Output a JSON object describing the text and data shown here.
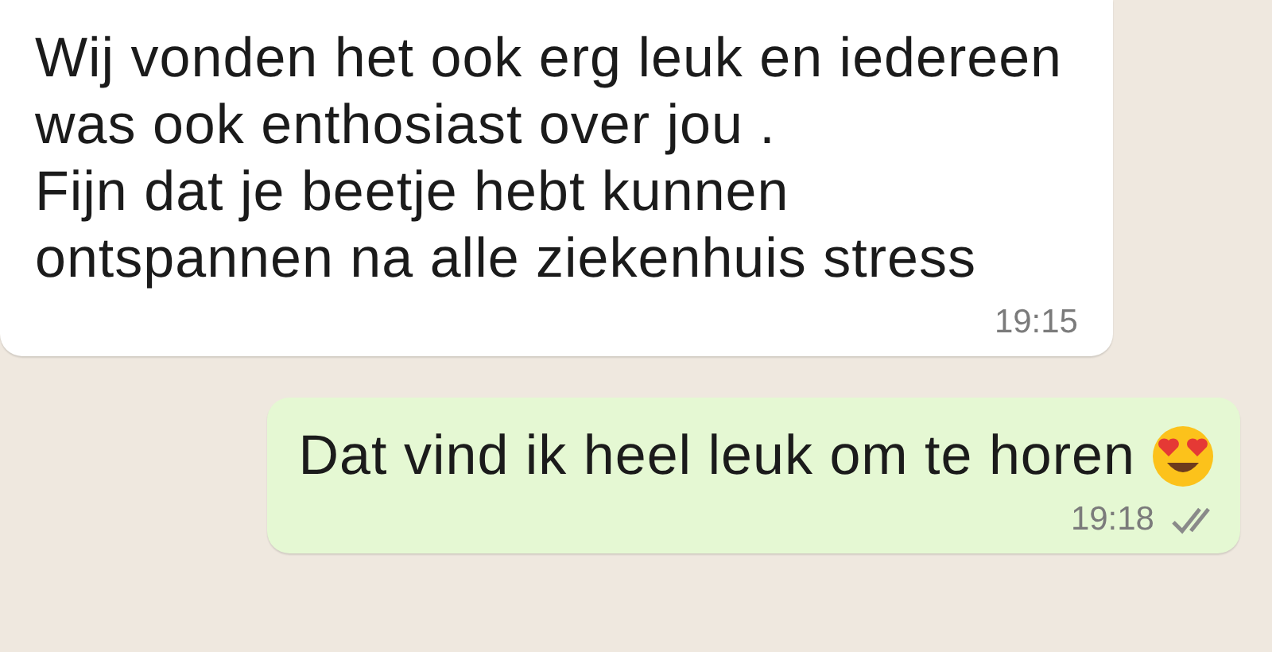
{
  "messages": [
    {
      "outgoing": false,
      "text": "Wij vonden het ook erg leuk en iedereen was ook enthosiast over jou .\nFijn dat je beetje hebt kunnen ontspannen na alle ziekenhuis stress",
      "time": "19:15"
    },
    {
      "outgoing": true,
      "text": "Dat vind ik heel leuk om te horen",
      "emoji": true,
      "time": "19:18",
      "delivered": true,
      "read": false
    }
  ]
}
